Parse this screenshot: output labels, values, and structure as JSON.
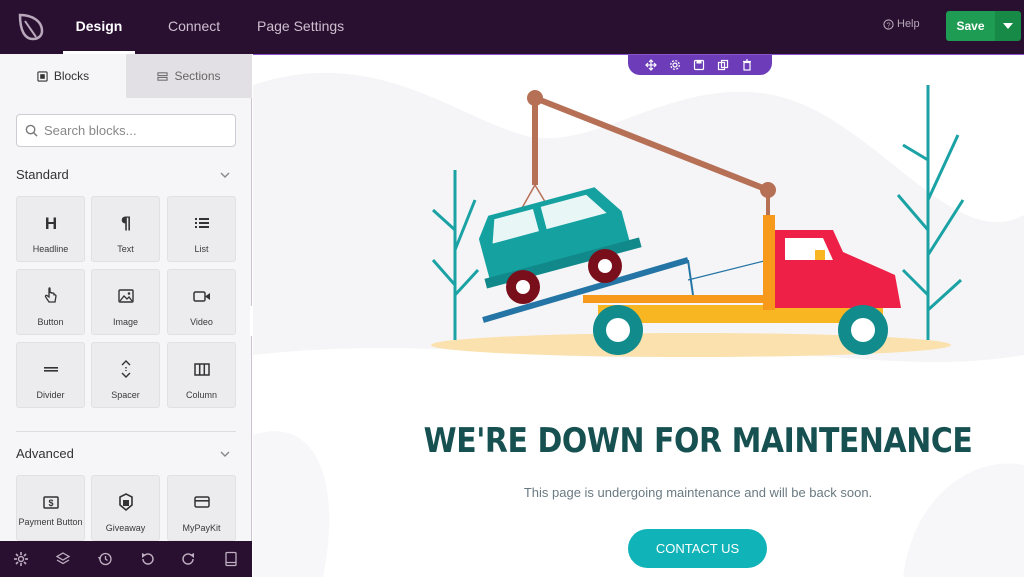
{
  "topbar": {
    "tabs": [
      {
        "label": "Design",
        "active": true
      },
      {
        "label": "Connect",
        "active": false
      },
      {
        "label": "Page Settings",
        "active": false
      }
    ],
    "help_label": "Help",
    "save_label": "Save"
  },
  "sidebar": {
    "tabs": {
      "blocks": "Blocks",
      "sections": "Sections"
    },
    "search_placeholder": "Search blocks...",
    "standard": {
      "title": "Standard",
      "blocks": [
        {
          "label": "Headline",
          "icon": "headline-icon"
        },
        {
          "label": "Text",
          "icon": "paragraph-icon"
        },
        {
          "label": "List",
          "icon": "list-icon"
        },
        {
          "label": "Button",
          "icon": "pointer-icon"
        },
        {
          "label": "Image",
          "icon": "image-icon"
        },
        {
          "label": "Video",
          "icon": "video-icon"
        },
        {
          "label": "Divider",
          "icon": "divider-icon"
        },
        {
          "label": "Spacer",
          "icon": "spacer-icon"
        },
        {
          "label": "Column",
          "icon": "column-icon"
        }
      ]
    },
    "advanced": {
      "title": "Advanced",
      "blocks": [
        {
          "label": "Payment Button",
          "icon": "payment-icon"
        },
        {
          "label": "Giveaway",
          "icon": "giveaway-icon"
        },
        {
          "label": "MyPayKit",
          "icon": "card-icon"
        }
      ]
    }
  },
  "canvas": {
    "headline": "WE'RE DOWN FOR MAINTENANCE",
    "subtext": "This page is undergoing maintenance and will be back soon.",
    "cta_label": "CONTACT US"
  },
  "colors": {
    "topbar_bg": "#2a1030",
    "save_green": "#1f9c53",
    "toolbar_purple": "#6d3cb9",
    "headline_teal": "#165050",
    "cta_teal": "#0fb3b8"
  }
}
